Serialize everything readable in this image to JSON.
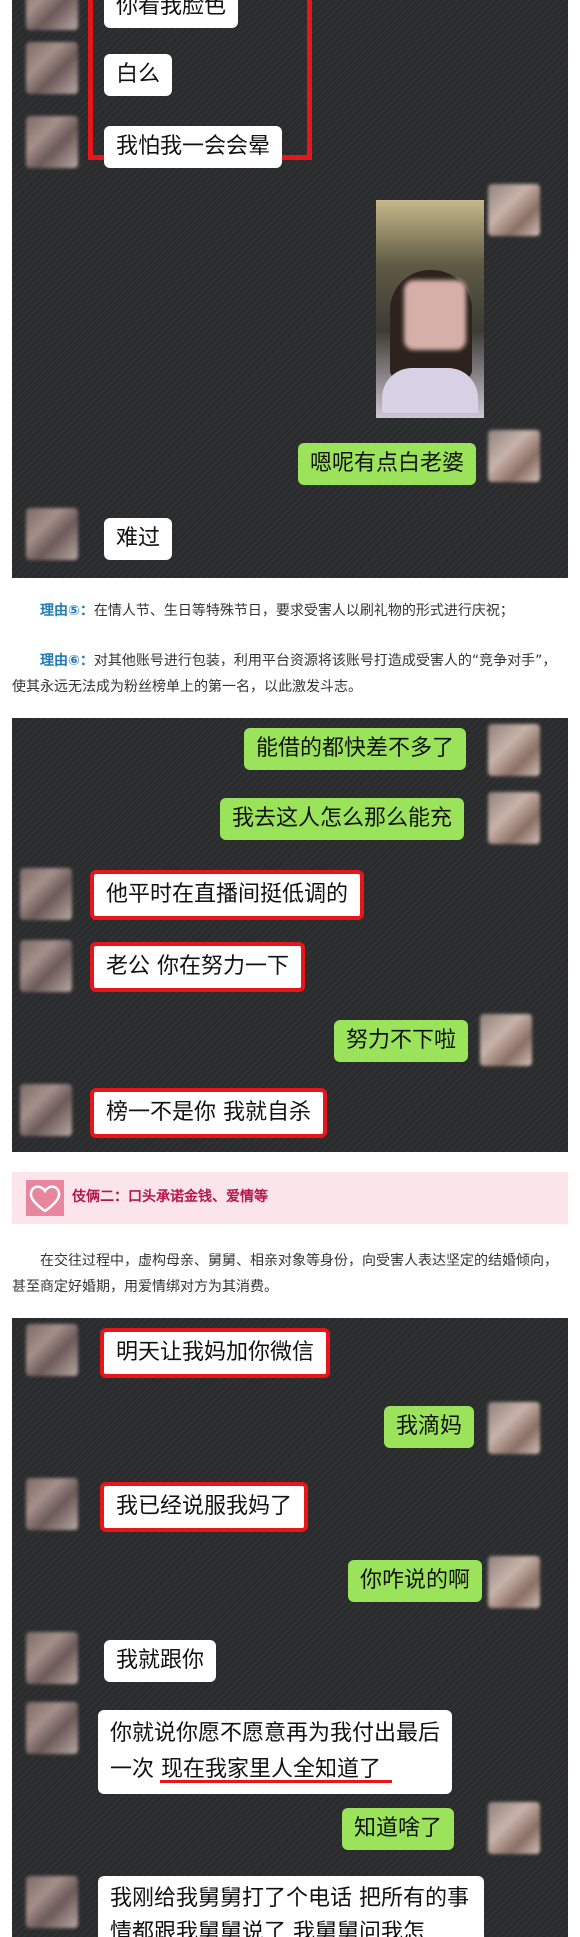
{
  "chat1": {
    "bubbles": [
      "你看我脸色",
      "白么",
      "我怕我一会会晕",
      "嗯呢有点白老婆",
      "难过"
    ]
  },
  "reasons": {
    "r5_label": "理由⑤：",
    "r5_text": "在情人节、生日等特殊节日，要求受害人以刷礼物的形式进行庆祝；",
    "r6_label": "理由⑥：",
    "r6_text": "对其他账号进行包装，利用平台资源将该账号打造成受害人的“竞争对手”，使其永远无法成为粉丝榜单上的第一名，以此激发斗志。"
  },
  "chat2": {
    "bubbles": [
      "能借的都快差不多了",
      "我去这人怎么那么能充",
      "他平时在直播间挺低调的",
      "老公 你在努力一下",
      "努力不下啦",
      "榜一不是你 我就自杀"
    ]
  },
  "section": {
    "title": "伎俩二：口头承诺金钱、爱情等",
    "intro": "在交往过程中，虚构母亲、舅舅、相亲对象等身份，向受害人表达坚定的结婚倾向，甚至商定好婚期，用爱情绑对方为其消费。"
  },
  "chat3": {
    "bubbles": [
      "明天让我妈加你微信",
      "我滴妈",
      "我已经说服我妈了",
      "你咋说的啊",
      "我就跟你",
      "你就说你愿不愿意再为我付出最后一次 现在我家里人全知道了",
      "知道啥了",
      "我刚给我舅舅打了个电话 把所有的事情都跟我舅舅说了 我舅舅问我怎"
    ]
  },
  "colors": {
    "accent_blue": "#1f7ab5",
    "highlight_red": "#e8151b",
    "bubble_green": "#9be35b",
    "banner_pink": "#fbe4ea"
  }
}
